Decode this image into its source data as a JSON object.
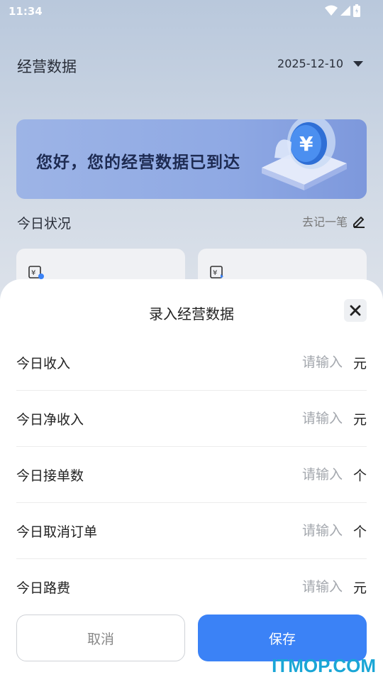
{
  "status_bar": {
    "time": "11:34"
  },
  "header": {
    "title": "经营数据",
    "date": "2025-12-10"
  },
  "banner": {
    "text": "您好，您的经营数据已到达"
  },
  "section": {
    "title": "今日状况",
    "record_link": "去记一笔"
  },
  "sheet": {
    "title": "录入经营数据",
    "rows": [
      {
        "label": "今日收入",
        "placeholder": "请输入",
        "unit": "元"
      },
      {
        "label": "今日净收入",
        "placeholder": "请输入",
        "unit": "元"
      },
      {
        "label": "今日接单数",
        "placeholder": "请输入",
        "unit": "个"
      },
      {
        "label": "今日取消订单",
        "placeholder": "请输入",
        "unit": "个"
      },
      {
        "label": "今日路费",
        "placeholder": "请输入",
        "unit": "元"
      }
    ],
    "cancel_label": "取消",
    "save_label": "保存"
  },
  "watermark": "ITMOP.COM",
  "colors": {
    "accent": "#3b82f6",
    "watermark": "#1aa6d6"
  }
}
